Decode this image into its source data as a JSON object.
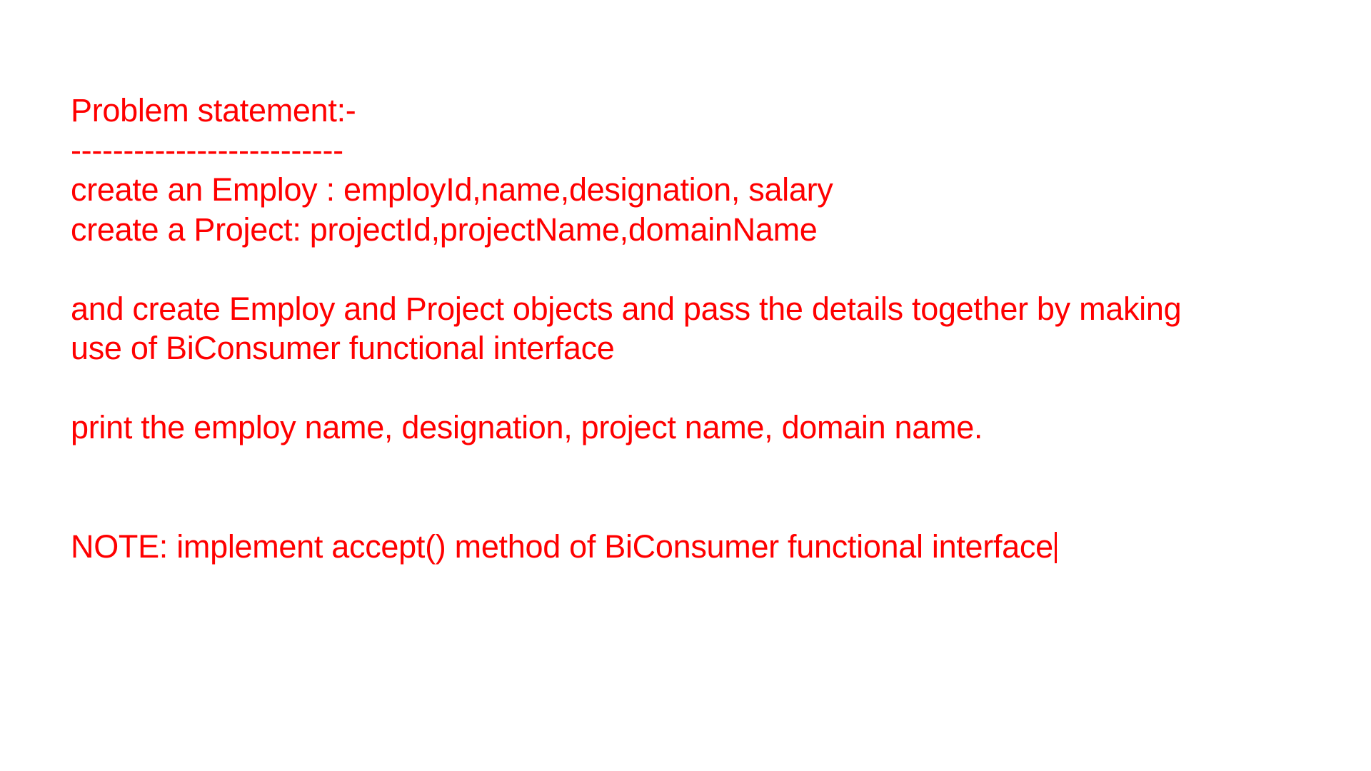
{
  "document": {
    "heading": "Problem statement:-",
    "underline": "--------------------------",
    "employ_line": "create an Employ : employId,name,designation, salary",
    "project_line": "create a Project: projectId,projectName,domainName",
    "task_line_1": "and create Employ and Project objects and pass the details together by making",
    "task_line_2": "use of BiConsumer functional interface",
    "print_line": "print the employ name, designation, project name, domain name.",
    "note_line": "NOTE: implement accept() method of BiConsumer functional interface"
  },
  "colors": {
    "text": "#ff0000",
    "background": "#ffffff"
  }
}
